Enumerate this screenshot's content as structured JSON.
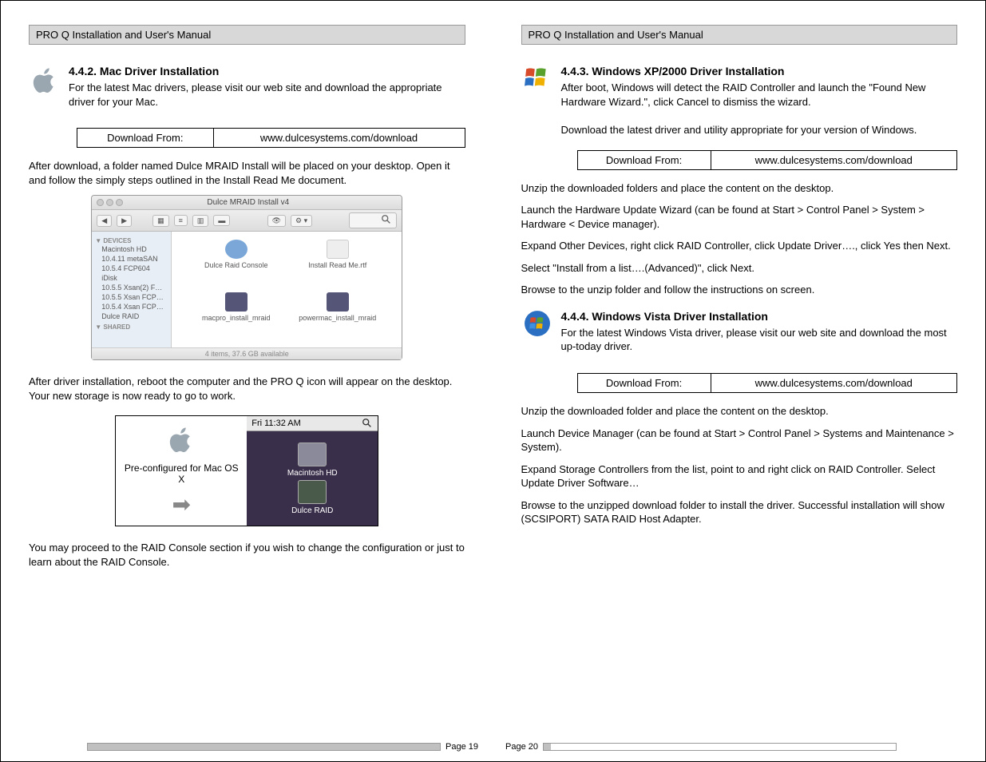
{
  "header_left": "PRO Q Installation and User's Manual",
  "header_right": "PRO Q Installation and User's Manual",
  "mac": {
    "heading": "4.4.2. Mac Driver Installation",
    "p1": "For the latest Mac drivers, please visit our web site and download the appropriate driver for your Mac.",
    "dl_label": "Download From:",
    "dl_url": "www.dulcesystems.com/download",
    "p2": "After download, a folder named Dulce MRAID Install will be placed on your desktop.  Open it and follow the simply steps outlined in the Install Read Me document.",
    "finder_title": "Dulce MRAID Install v4",
    "sidebar_head1": "▼ DEVICES",
    "sidebar_items": [
      "Macintosh HD",
      "10.4.11 metaSAN",
      "10.5.4 FCP604",
      "iDisk",
      "10.5.5 Xsan(2) F…",
      "10.5.5 Xsan FCP…",
      "10.5.4 Xsan FCP…",
      "Dulce  RAID"
    ],
    "sidebar_head2": "▼ SHARED",
    "icons": [
      "Dulce Raid Console",
      "Install Read Me.rtf",
      "macpro_install_mraid",
      "powermac_install_mraid"
    ],
    "finder_status": "4 items, 37.6 GB available",
    "p3": "After driver installation, reboot the computer and the PRO Q icon will appear on the desktop.  Your new storage is now ready to go to work.",
    "preconf": "Pre-configured for Mac OS X",
    "menubar_time": "Fri 11:32 AM",
    "desk_icon1": "Macintosh HD",
    "desk_icon2": "Dulce RAID",
    "p4": "You may proceed to the RAID Console section if you wish to change the configuration or just to learn about the RAID Console."
  },
  "xp": {
    "heading": "4.4.3. Windows XP/2000 Driver Installation",
    "p1": "After boot, Windows will detect the RAID Controller and launch the \"Found New Hardware Wizard.\", click Cancel to dismiss the wizard.",
    "p2": "Download the latest driver and utility appropriate for your version of Windows.",
    "dl_label": "Download From:",
    "dl_url": "www.dulcesystems.com/download",
    "p3": "Unzip the downloaded folders and place the content on the desktop.",
    "p4": "Launch the Hardware Update Wizard (can be found at Start > Control Panel > System > Hardware < Device manager).",
    "p5": "Expand Other Devices, right click RAID Controller, click Update Driver…., click Yes then Next.",
    "p6": "Select \"Install from a list….(Advanced)\", click Next.",
    "p7": "Browse to the unzip folder and follow the instructions on screen."
  },
  "vista": {
    "heading": "4.4.4. Windows Vista Driver Installation",
    "p1": "For the latest Windows Vista driver, please visit our web site and download the most up-today driver.",
    "dl_label": "Download From:",
    "dl_url": "www.dulcesystems.com/download",
    "p2": "Unzip the downloaded folder and place the content on the desktop.",
    "p3": "Launch Device Manager (can be found at Start > Control Panel > Systems and Maintenance > System).",
    "p4": "Expand Storage Controllers from the list, point to and right click on RAID Controller.   Select Update Driver Software…",
    "p5": "Browse to the unzipped download folder to install the driver.  Successful installation will show (SCSIPORT) SATA RAID Host Adapter."
  },
  "page_left": "Page 19",
  "page_right": "Page 20"
}
